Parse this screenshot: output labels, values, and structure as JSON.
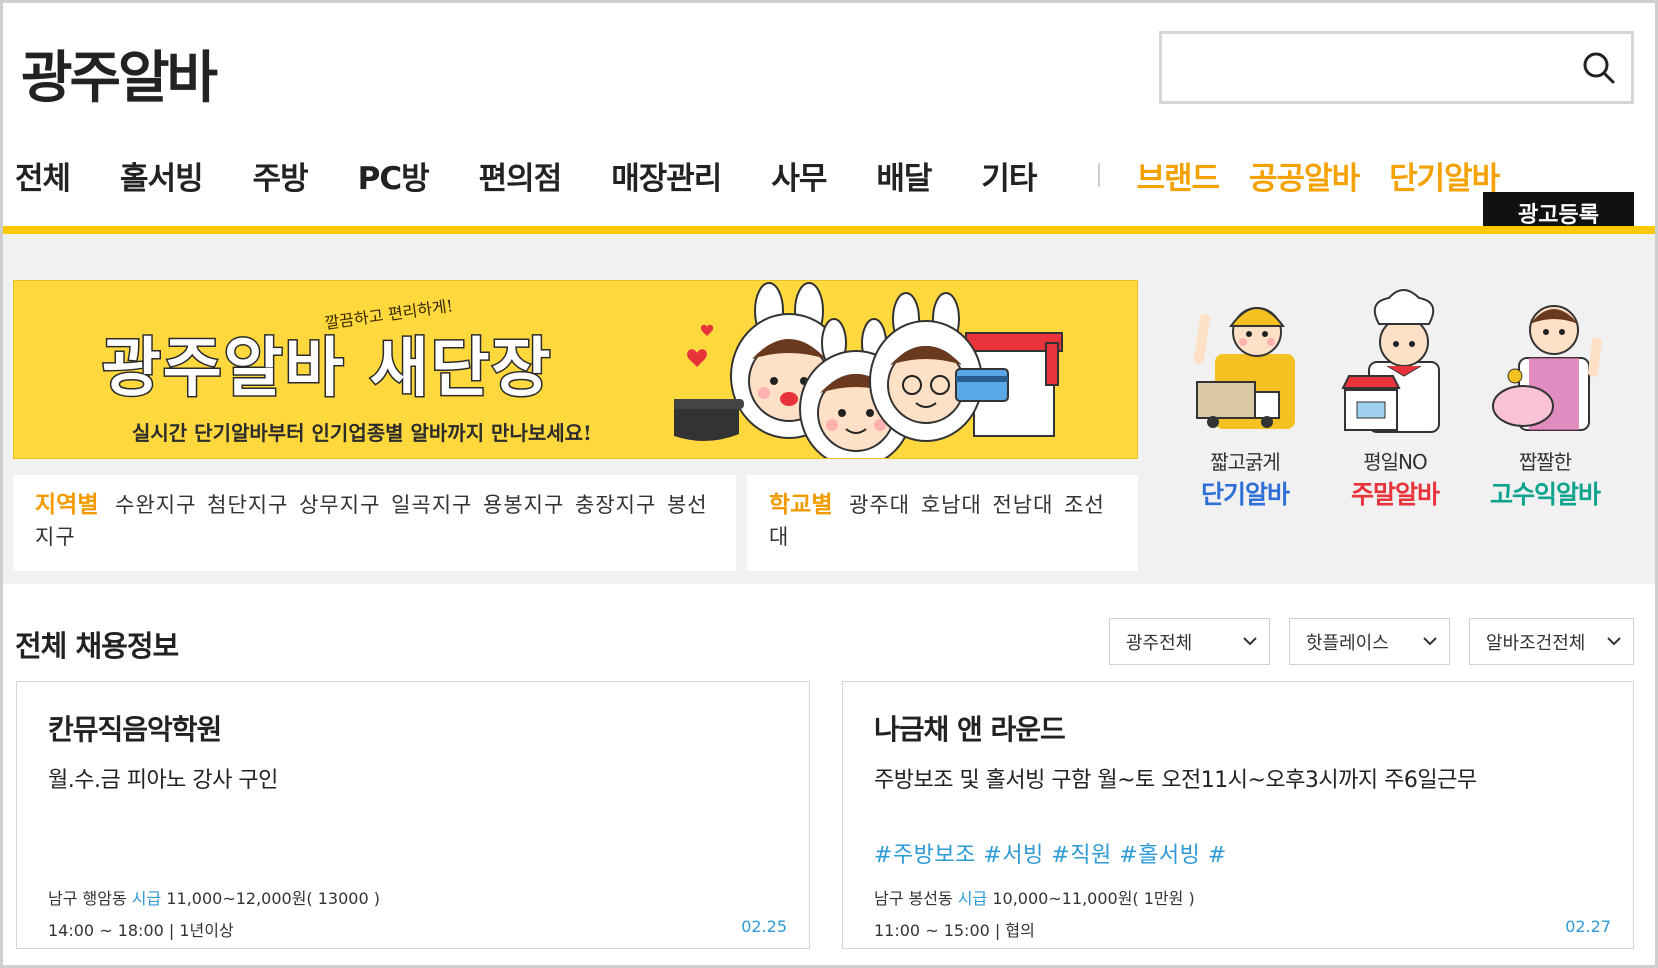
{
  "header": {
    "logo": "광주알바",
    "search_placeholder": ""
  },
  "nav": {
    "items": [
      "전체",
      "홀서빙",
      "주방",
      "PC방",
      "편의점",
      "매장관리",
      "사무",
      "배달",
      "기타"
    ],
    "highlight_items": [
      "브랜드",
      "공공알바",
      "단기알바"
    ],
    "ad_button": "광고등록"
  },
  "banner": {
    "title": "광주알바 새단장",
    "slogan": "깔끔하고 편리하게!",
    "subtitle": "실시간 단기알바부터 인기업종별 알바까지 만나보세요!"
  },
  "filters": {
    "region": {
      "label": "지역별",
      "items": [
        "수완지구",
        "첨단지구",
        "상무지구",
        "일곡지구",
        "용봉지구",
        "충장지구",
        "봉선지구"
      ]
    },
    "school": {
      "label": "학교별",
      "items": [
        "광주대",
        "호남대",
        "전남대",
        "조선대"
      ]
    }
  },
  "promos": [
    {
      "small": "짧고굵게",
      "big": "단기알바",
      "color": "#2f6fd6"
    },
    {
      "small": "평일NO",
      "big": "주말알바",
      "color": "#e8333b"
    },
    {
      "small": "짭짤한",
      "big": "고수익알바",
      "color": "#0fa38f"
    }
  ],
  "listing": {
    "title": "전체 채용정보",
    "dropdowns": [
      "광주전체",
      "핫플레이스",
      "알바조건전체"
    ],
    "cards": [
      {
        "name": "칸뮤직음악학원",
        "desc": "월.수.금 피아노 강사 구인",
        "tags": "",
        "area": "남구 행암동",
        "pay_type": "시급",
        "pay": "11,000~12,000원( 13000 )",
        "time": "14:00 ~ 18:00 | 1년이상",
        "date": "02.25"
      },
      {
        "name": "나금채 앤 라운드",
        "desc": "주방보조 및 홀서빙 구함 월~토 오전11시~오후3시까지 주6일근무",
        "tags": "#주방보조 #서빙 #직원 #홀서빙 #",
        "area": "남구 봉선동",
        "pay_type": "시급",
        "pay": "10,000~11,000원( 1만원 )",
        "time": "11:00 ~ 15:00 | 협의",
        "date": "02.27"
      }
    ]
  },
  "colors": {
    "accent_yellow": "#ffc900",
    "orange": "#f5a100",
    "link_blue": "#2e9ad6"
  }
}
